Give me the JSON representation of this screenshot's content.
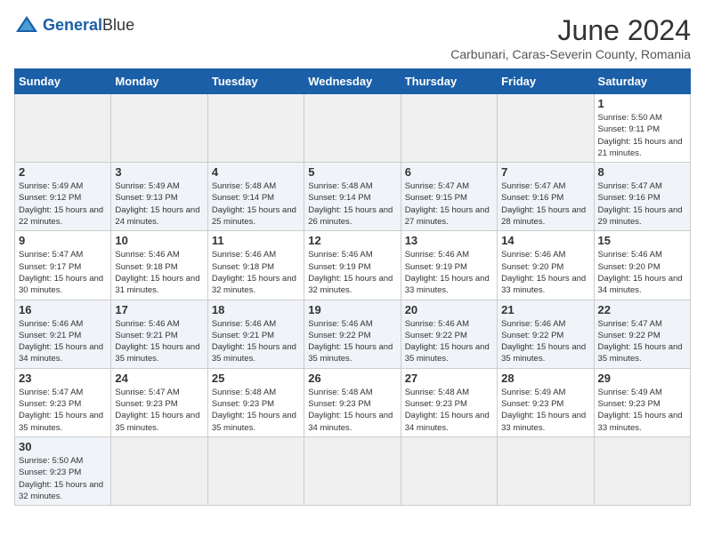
{
  "header": {
    "logo_general": "General",
    "logo_blue": "Blue",
    "title": "June 2024",
    "subtitle": "Carbunari, Caras-Severin County, Romania"
  },
  "weekdays": [
    "Sunday",
    "Monday",
    "Tuesday",
    "Wednesday",
    "Thursday",
    "Friday",
    "Saturday"
  ],
  "weeks": [
    [
      {
        "day": "",
        "info": ""
      },
      {
        "day": "",
        "info": ""
      },
      {
        "day": "",
        "info": ""
      },
      {
        "day": "",
        "info": ""
      },
      {
        "day": "",
        "info": ""
      },
      {
        "day": "",
        "info": ""
      },
      {
        "day": "1",
        "info": "Sunrise: 5:50 AM\nSunset: 9:11 PM\nDaylight: 15 hours and 21 minutes."
      }
    ],
    [
      {
        "day": "2",
        "info": "Sunrise: 5:49 AM\nSunset: 9:12 PM\nDaylight: 15 hours and 22 minutes."
      },
      {
        "day": "3",
        "info": "Sunrise: 5:49 AM\nSunset: 9:13 PM\nDaylight: 15 hours and 24 minutes."
      },
      {
        "day": "4",
        "info": "Sunrise: 5:48 AM\nSunset: 9:14 PM\nDaylight: 15 hours and 25 minutes."
      },
      {
        "day": "5",
        "info": "Sunrise: 5:48 AM\nSunset: 9:14 PM\nDaylight: 15 hours and 26 minutes."
      },
      {
        "day": "6",
        "info": "Sunrise: 5:47 AM\nSunset: 9:15 PM\nDaylight: 15 hours and 27 minutes."
      },
      {
        "day": "7",
        "info": "Sunrise: 5:47 AM\nSunset: 9:16 PM\nDaylight: 15 hours and 28 minutes."
      },
      {
        "day": "8",
        "info": "Sunrise: 5:47 AM\nSunset: 9:16 PM\nDaylight: 15 hours and 29 minutes."
      }
    ],
    [
      {
        "day": "9",
        "info": "Sunrise: 5:47 AM\nSunset: 9:17 PM\nDaylight: 15 hours and 30 minutes."
      },
      {
        "day": "10",
        "info": "Sunrise: 5:46 AM\nSunset: 9:18 PM\nDaylight: 15 hours and 31 minutes."
      },
      {
        "day": "11",
        "info": "Sunrise: 5:46 AM\nSunset: 9:18 PM\nDaylight: 15 hours and 32 minutes."
      },
      {
        "day": "12",
        "info": "Sunrise: 5:46 AM\nSunset: 9:19 PM\nDaylight: 15 hours and 32 minutes."
      },
      {
        "day": "13",
        "info": "Sunrise: 5:46 AM\nSunset: 9:19 PM\nDaylight: 15 hours and 33 minutes."
      },
      {
        "day": "14",
        "info": "Sunrise: 5:46 AM\nSunset: 9:20 PM\nDaylight: 15 hours and 33 minutes."
      },
      {
        "day": "15",
        "info": "Sunrise: 5:46 AM\nSunset: 9:20 PM\nDaylight: 15 hours and 34 minutes."
      }
    ],
    [
      {
        "day": "16",
        "info": "Sunrise: 5:46 AM\nSunset: 9:21 PM\nDaylight: 15 hours and 34 minutes."
      },
      {
        "day": "17",
        "info": "Sunrise: 5:46 AM\nSunset: 9:21 PM\nDaylight: 15 hours and 35 minutes."
      },
      {
        "day": "18",
        "info": "Sunrise: 5:46 AM\nSunset: 9:21 PM\nDaylight: 15 hours and 35 minutes."
      },
      {
        "day": "19",
        "info": "Sunrise: 5:46 AM\nSunset: 9:22 PM\nDaylight: 15 hours and 35 minutes."
      },
      {
        "day": "20",
        "info": "Sunrise: 5:46 AM\nSunset: 9:22 PM\nDaylight: 15 hours and 35 minutes."
      },
      {
        "day": "21",
        "info": "Sunrise: 5:46 AM\nSunset: 9:22 PM\nDaylight: 15 hours and 35 minutes."
      },
      {
        "day": "22",
        "info": "Sunrise: 5:47 AM\nSunset: 9:22 PM\nDaylight: 15 hours and 35 minutes."
      }
    ],
    [
      {
        "day": "23",
        "info": "Sunrise: 5:47 AM\nSunset: 9:23 PM\nDaylight: 15 hours and 35 minutes."
      },
      {
        "day": "24",
        "info": "Sunrise: 5:47 AM\nSunset: 9:23 PM\nDaylight: 15 hours and 35 minutes."
      },
      {
        "day": "25",
        "info": "Sunrise: 5:48 AM\nSunset: 9:23 PM\nDaylight: 15 hours and 35 minutes."
      },
      {
        "day": "26",
        "info": "Sunrise: 5:48 AM\nSunset: 9:23 PM\nDaylight: 15 hours and 34 minutes."
      },
      {
        "day": "27",
        "info": "Sunrise: 5:48 AM\nSunset: 9:23 PM\nDaylight: 15 hours and 34 minutes."
      },
      {
        "day": "28",
        "info": "Sunrise: 5:49 AM\nSunset: 9:23 PM\nDaylight: 15 hours and 33 minutes."
      },
      {
        "day": "29",
        "info": "Sunrise: 5:49 AM\nSunset: 9:23 PM\nDaylight: 15 hours and 33 minutes."
      }
    ],
    [
      {
        "day": "30",
        "info": "Sunrise: 5:50 AM\nSunset: 9:23 PM\nDaylight: 15 hours and 32 minutes."
      },
      {
        "day": "",
        "info": ""
      },
      {
        "day": "",
        "info": ""
      },
      {
        "day": "",
        "info": ""
      },
      {
        "day": "",
        "info": ""
      },
      {
        "day": "",
        "info": ""
      },
      {
        "day": "",
        "info": ""
      }
    ]
  ]
}
